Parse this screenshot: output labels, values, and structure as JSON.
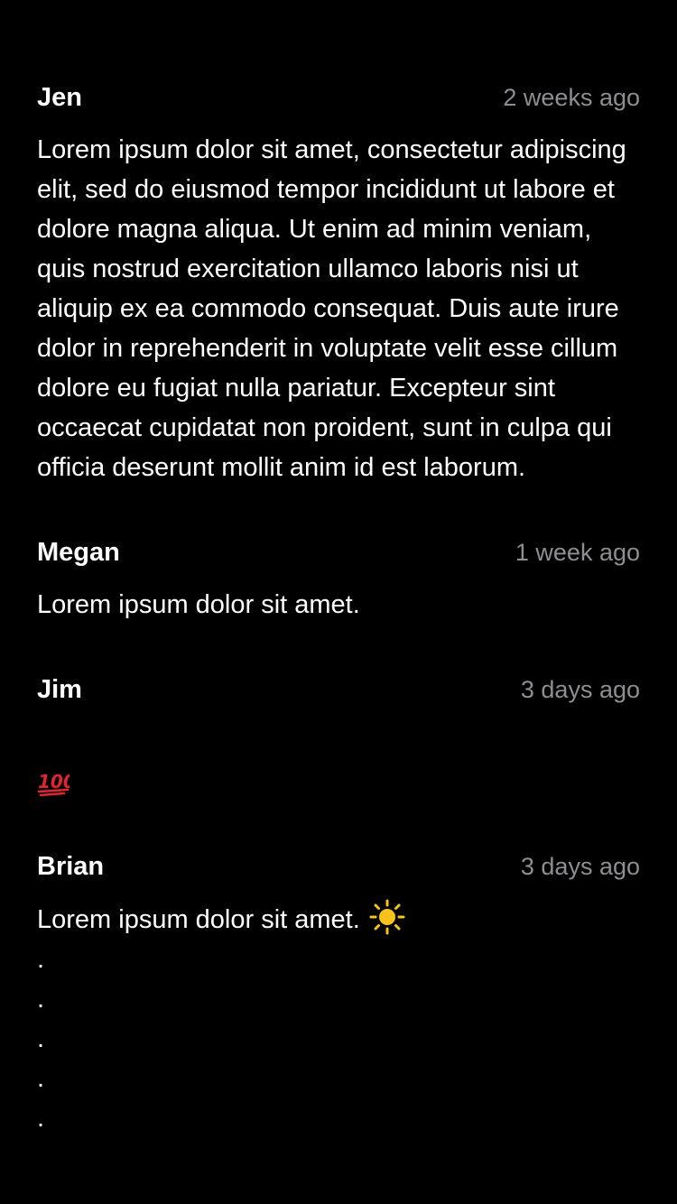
{
  "comments": [
    {
      "author": "Jen",
      "time": "2 weeks ago",
      "text": "Lorem ipsum dolor sit amet, consectetur adipiscing elit, sed do eiusmod tempor incididunt ut labore et dolore magna aliqua. Ut enim ad minim veniam, quis nostrud exercitation ullamco laboris nisi ut aliquip ex ea commodo consequat. Duis aute irure dolor in reprehenderit in voluptate velit esse cillum dolore eu fugiat nulla pariatur. Excepteur sint occaecat cupidatat non proident, sunt in culpa qui officia deserunt mollit anim id est laborum."
    },
    {
      "author": "Megan",
      "time": "1 week ago",
      "text": "Lorem ipsum dolor sit amet."
    },
    {
      "author": "Jim",
      "time": "3 days ago",
      "emoji": "hundred-points-icon"
    },
    {
      "author": "Brian",
      "time": "3 days ago",
      "text": "Lorem ipsum dolor sit amet.",
      "emoji": "sun-icon",
      "trailing_lines": [
        ".",
        ".",
        ".",
        ".",
        "."
      ]
    }
  ],
  "colors": {
    "background": "#000000",
    "primary_text": "#ffffff",
    "secondary_text": "#8e8e93",
    "emoji_red": "#e0262d",
    "sun_yellow": "#f7c31a"
  }
}
